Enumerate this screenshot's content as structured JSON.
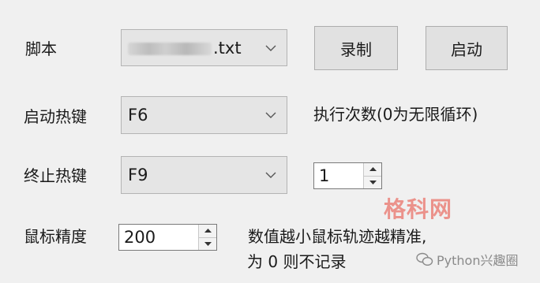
{
  "script": {
    "label": "脚本",
    "file_value": ".txt",
    "record_button": "录制",
    "start_button": "启动"
  },
  "start_hotkey": {
    "label": "启动热键",
    "value": "F6",
    "exec_label": "执行次数(0为无限循环)"
  },
  "stop_hotkey": {
    "label": "终止热键",
    "value": "F9",
    "exec_count": "1"
  },
  "mouse_precision": {
    "label": "鼠标精度",
    "value": "200",
    "hint_line1": "数值越小鼠标轨迹越精准,",
    "hint_line2": "为 0 则不记录"
  },
  "watermarks": {
    "site": "格科网",
    "account": "Python兴趣圈"
  },
  "colors": {
    "window_bg": "#f0f0f0",
    "combo_bg": "#e5e5e5",
    "watermark_red": "#e8463a"
  }
}
